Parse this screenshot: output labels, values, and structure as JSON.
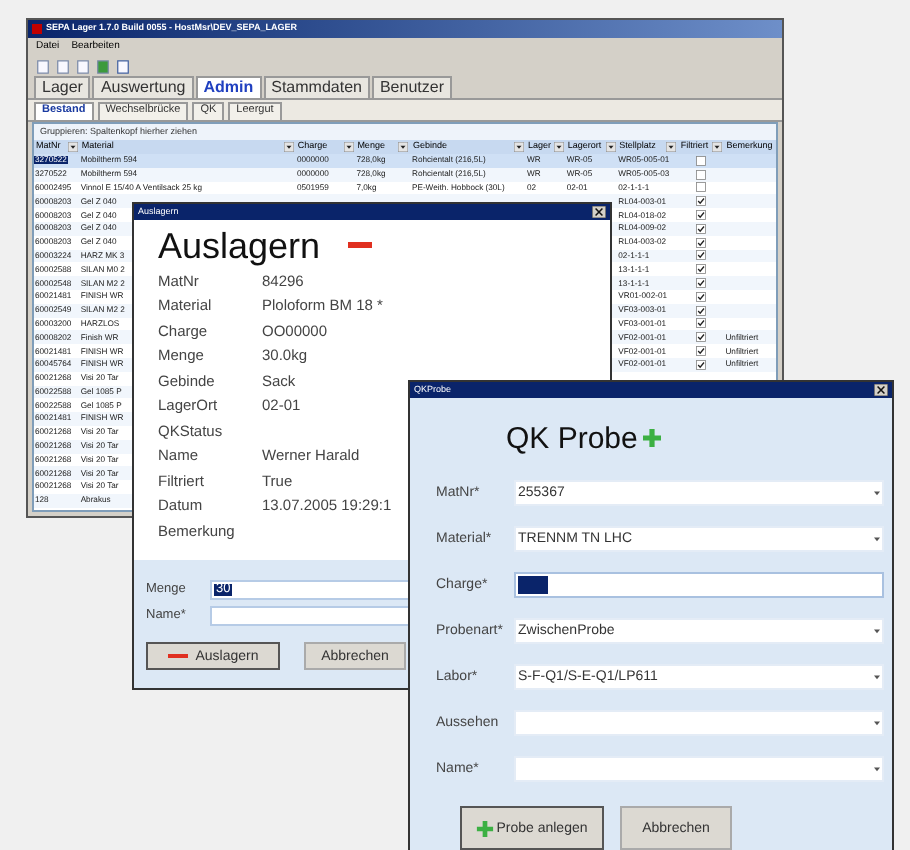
{
  "main_window": {
    "title": "SEPA Lager 1.7.0 Build 0055 - HostMsr\\DEV_SEPA_LAGER",
    "menu": [
      "Datei",
      "Bearbeiten"
    ],
    "tabs": [
      {
        "label": "Lager",
        "selected": false
      },
      {
        "label": "Auswertung",
        "selected": false
      },
      {
        "label": "Admin",
        "selected": true
      },
      {
        "label": "Stammdaten",
        "selected": false
      },
      {
        "label": "Benutzer",
        "selected": false
      }
    ],
    "subtabs": [
      {
        "label": "Bestand",
        "selected": true
      },
      {
        "label": "Wechselbrücke",
        "selected": false
      },
      {
        "label": "QK",
        "selected": false
      },
      {
        "label": "Leergut",
        "selected": false
      }
    ],
    "group_hint": "Gruppieren: Spaltenkopf hierher ziehen",
    "table": {
      "columns": [
        {
          "label": "MatNr",
          "kind": "text"
        },
        {
          "label": "Material",
          "kind": "text"
        },
        {
          "label": "Charge",
          "kind": "text"
        },
        {
          "label": "Menge",
          "kind": "text"
        },
        {
          "label": "Gebinde",
          "kind": "text"
        },
        {
          "label": "Lager",
          "kind": "text"
        },
        {
          "label": "Lagerort",
          "kind": "text"
        },
        {
          "label": "Stellplatz",
          "kind": "text"
        },
        {
          "label": "Filtriert",
          "kind": "check"
        },
        {
          "label": "Bemerkung",
          "kind": "text"
        }
      ],
      "rows": [
        {
          "selected": true,
          "cells": [
            "3270522",
            "Mobiltherm 594",
            "0000000",
            "728,0kg",
            "Rohcientalt (216,5L)",
            "WR",
            "WR-05",
            "WR05-005-01",
            false
          ]
        },
        {
          "selected": false,
          "cells": [
            "3270522",
            "Mobiltherm 594",
            "0000000",
            "728,0kg",
            "Rohcientalt (216,5L)",
            "WR",
            "WR-05",
            "WR05-005-03",
            false
          ]
        },
        {
          "selected": false,
          "cells": [
            "60002495",
            "Vinnol E 15/40 A Ventilsack 25 kg",
            "0501959",
            "7,0kg",
            "PE-Weith. Hobbock (30L)",
            "02",
            "02-01",
            "02-1-1-1",
            false
          ]
        },
        {
          "selected": false,
          "cells": [
            "60008203",
            "Gel Z 040",
            null,
            null,
            null,
            null,
            null,
            "RL04-003-01",
            true
          ]
        },
        {
          "selected": false,
          "cells": [
            "60008203",
            "Gel Z 040",
            null,
            null,
            null,
            null,
            null,
            "RL04-018-02",
            true
          ]
        },
        {
          "selected": false,
          "cells": [
            "60008203",
            "Gel Z 040",
            null,
            null,
            null,
            null,
            null,
            "RL04-009-02",
            true
          ]
        },
        {
          "selected": false,
          "cells": [
            "60008203",
            "Gel Z 040",
            null,
            null,
            null,
            null,
            null,
            "RL04-003-02",
            true
          ]
        },
        {
          "selected": false,
          "cells": [
            "60003224",
            "HARZ MK 3",
            null,
            null,
            null,
            null,
            null,
            "02-1-1-1",
            true
          ]
        },
        {
          "selected": false,
          "cells": [
            "60002588",
            "SILAN M0 2",
            null,
            null,
            null,
            null,
            null,
            "13-1-1-1",
            true
          ]
        },
        {
          "selected": false,
          "cells": [
            "60002548",
            "SILAN M2 2",
            null,
            null,
            null,
            null,
            null,
            "13-1-1-1",
            true
          ]
        },
        {
          "selected": false,
          "cells": [
            "60021481",
            "FINISH WR",
            null,
            null,
            null,
            null,
            null,
            "VR01-002-01",
            true
          ]
        },
        {
          "selected": false,
          "cells": [
            "60002549",
            "SILAN M2 2",
            null,
            null,
            null,
            null,
            null,
            "VF03-003-01",
            true
          ]
        },
        {
          "selected": false,
          "cells": [
            "60003200",
            "HARZLOS",
            null,
            null,
            null,
            null,
            null,
            "VF03-001-01",
            true
          ]
        },
        {
          "selected": false,
          "cells": [
            "60008202",
            "Finish WR",
            null,
            null,
            null,
            null,
            null,
            "VF02-001-01",
            true,
            "Unfiltriert"
          ]
        },
        {
          "selected": false,
          "cells": [
            "60021481",
            "FINISH WR",
            null,
            null,
            null,
            null,
            null,
            "VF02-001-01",
            true,
            "Unfiltriert"
          ]
        },
        {
          "selected": false,
          "cells": [
            "60045764",
            "FINISH WR",
            null,
            null,
            null,
            null,
            null,
            "VF02-001-01",
            true,
            "Unfiltriert"
          ]
        },
        {
          "selected": false,
          "cells": [
            "60021268",
            "Visi 20 Tar"
          ]
        },
        {
          "selected": false,
          "cells": [
            "60022588",
            "Gel 1085 P"
          ]
        },
        {
          "selected": false,
          "cells": [
            "60022588",
            "Gel 1085 P"
          ]
        },
        {
          "selected": false,
          "cells": [
            "60021481",
            "FINISH WR"
          ]
        },
        {
          "selected": false,
          "cells": [
            "60021268",
            "Visi 20 Tar"
          ]
        },
        {
          "selected": false,
          "cells": [
            "60021268",
            "Visi 20 Tar"
          ]
        },
        {
          "selected": false,
          "cells": [
            "60021268",
            "Visi 20 Tar"
          ]
        },
        {
          "selected": false,
          "cells": [
            "60021268",
            "Visi 20 Tar"
          ]
        },
        {
          "selected": false,
          "cells": [
            "60021268",
            "Visi 20 Tar"
          ]
        },
        {
          "selected": false,
          "cells": [
            "128",
            "Abrakus"
          ]
        }
      ]
    }
  },
  "auslagern_dialog": {
    "title": "Auslagern",
    "heading": "Auslagern",
    "fields": [
      {
        "label": "MatNr",
        "value": "84296"
      },
      {
        "label": "Material",
        "value": "Ploloform BM 18 *"
      },
      {
        "label": "Charge",
        "value": "OO00000"
      },
      {
        "label": "Menge",
        "value": "30.0kg"
      },
      {
        "label": "Gebinde",
        "value": "Sack"
      },
      {
        "label": "LagerOrt",
        "value": "02-01"
      },
      {
        "label": "QKStatus"
      },
      {
        "label": "Name",
        "value": "Werner Harald"
      },
      {
        "label": "Filtriert",
        "value": "True"
      },
      {
        "label": "Datum",
        "value": "13.07.2005 19:29:1"
      },
      {
        "label": "Bemerkung"
      }
    ],
    "inputs": [
      {
        "label": "Menge",
        "value": "30",
        "highlighted": true
      },
      {
        "label": "Name*"
      }
    ],
    "buttons": [
      {
        "label": "Auslagern",
        "kind": "remove"
      },
      {
        "label": "Abbrechen",
        "kind": "plain"
      }
    ]
  },
  "qk_dialog": {
    "title": "QKProbe",
    "heading": "QK Probe",
    "fields": [
      {
        "label": "MatNr*",
        "value": "255367",
        "kind": "combo"
      },
      {
        "label": "Material*",
        "value": "TRENNM TN LHC",
        "kind": "combo"
      },
      {
        "label": "Charge*",
        "kind": "text",
        "highlighted": true
      },
      {
        "label": "Probenart*",
        "value": "ZwischenProbe",
        "kind": "combo"
      },
      {
        "label": "Labor*",
        "value": "S-F-Q1/S-E-Q1/LP611",
        "kind": "combo"
      },
      {
        "label": "Aussehen",
        "kind": "combo"
      },
      {
        "label": "Name*",
        "kind": "combo"
      }
    ],
    "buttons": [
      {
        "label": "Probe anlegen",
        "kind": "add"
      },
      {
        "label": "Abbrechen",
        "kind": "plain"
      }
    ]
  }
}
